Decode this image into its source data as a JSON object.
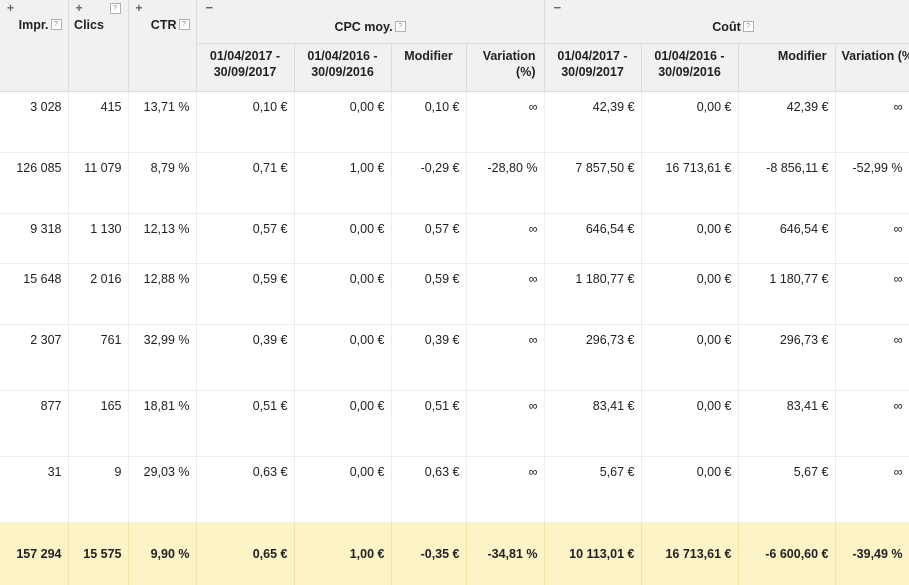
{
  "headers": {
    "impr": "Impr.",
    "clics": "Clics",
    "ctr": "CTR",
    "cpc_group": "CPC moy.",
    "cout_group": "Coût",
    "expand": "+",
    "collapse": "−",
    "help": "?",
    "period_1": "01/04/2017 - 30/09/2017",
    "period_2": "01/04/2016 - 30/09/2016",
    "modifier": "Modifier",
    "variation": "Variation (%)"
  },
  "rows": [
    {
      "impr": "3 028",
      "clics": "415",
      "ctr": "13,71 %",
      "cpc_p1": "0,10 €",
      "cpc_p2": "0,00 €",
      "cpc_mod": "0,10 €",
      "cpc_var": "∞",
      "cout_p1": "42,39 €",
      "cout_p2": "0,00 €",
      "cout_mod": "42,39 €",
      "cout_var": "∞"
    },
    {
      "impr": "126 085",
      "clics": "11 079",
      "ctr": "8,79 %",
      "cpc_p1": "0,71 €",
      "cpc_p2": "1,00 €",
      "cpc_mod": "-0,29 €",
      "cpc_var": "-28,80 %",
      "cout_p1": "7 857,50 €",
      "cout_p2": "16 713,61 €",
      "cout_mod": "-8 856,11 €",
      "cout_var": "-52,99 %"
    },
    {
      "impr": "9 318",
      "clics": "1 130",
      "ctr": "12,13 %",
      "cpc_p1": "0,57 €",
      "cpc_p2": "0,00 €",
      "cpc_mod": "0,57 €",
      "cpc_var": "∞",
      "cout_p1": "646,54 €",
      "cout_p2": "0,00 €",
      "cout_mod": "646,54 €",
      "cout_var": "∞"
    },
    {
      "impr": "15 648",
      "clics": "2 016",
      "ctr": "12,88 %",
      "cpc_p1": "0,59 €",
      "cpc_p2": "0,00 €",
      "cpc_mod": "0,59 €",
      "cpc_var": "∞",
      "cout_p1": "1 180,77 €",
      "cout_p2": "0,00 €",
      "cout_mod": "1 180,77 €",
      "cout_var": "∞"
    },
    {
      "impr": "2 307",
      "clics": "761",
      "ctr": "32,99 %",
      "cpc_p1": "0,39 €",
      "cpc_p2": "0,00 €",
      "cpc_mod": "0,39 €",
      "cpc_var": "∞",
      "cout_p1": "296,73 €",
      "cout_p2": "0,00 €",
      "cout_mod": "296,73 €",
      "cout_var": "∞"
    },
    {
      "impr": "877",
      "clics": "165",
      "ctr": "18,81 %",
      "cpc_p1": "0,51 €",
      "cpc_p2": "0,00 €",
      "cpc_mod": "0,51 €",
      "cpc_var": "∞",
      "cout_p1": "83,41 €",
      "cout_p2": "0,00 €",
      "cout_mod": "83,41 €",
      "cout_var": "∞"
    },
    {
      "impr": "31",
      "clics": "9",
      "ctr": "29,03 %",
      "cpc_p1": "0,63 €",
      "cpc_p2": "0,00 €",
      "cpc_mod": "0,63 €",
      "cpc_var": "∞",
      "cout_p1": "5,67 €",
      "cout_p2": "0,00 €",
      "cout_mod": "5,67 €",
      "cout_var": "∞"
    }
  ],
  "total": {
    "impr": "157 294",
    "clics": "15 575",
    "ctr": "9,90 %",
    "cpc_p1": "0,65 €",
    "cpc_p2": "1,00 €",
    "cpc_mod": "-0,35 €",
    "cpc_var": "-34,81 %",
    "cout_p1": "10 113,01 €",
    "cout_p2": "16 713,61 €",
    "cout_mod": "-6 600,60 €",
    "cout_var": "-39,49 %"
  }
}
